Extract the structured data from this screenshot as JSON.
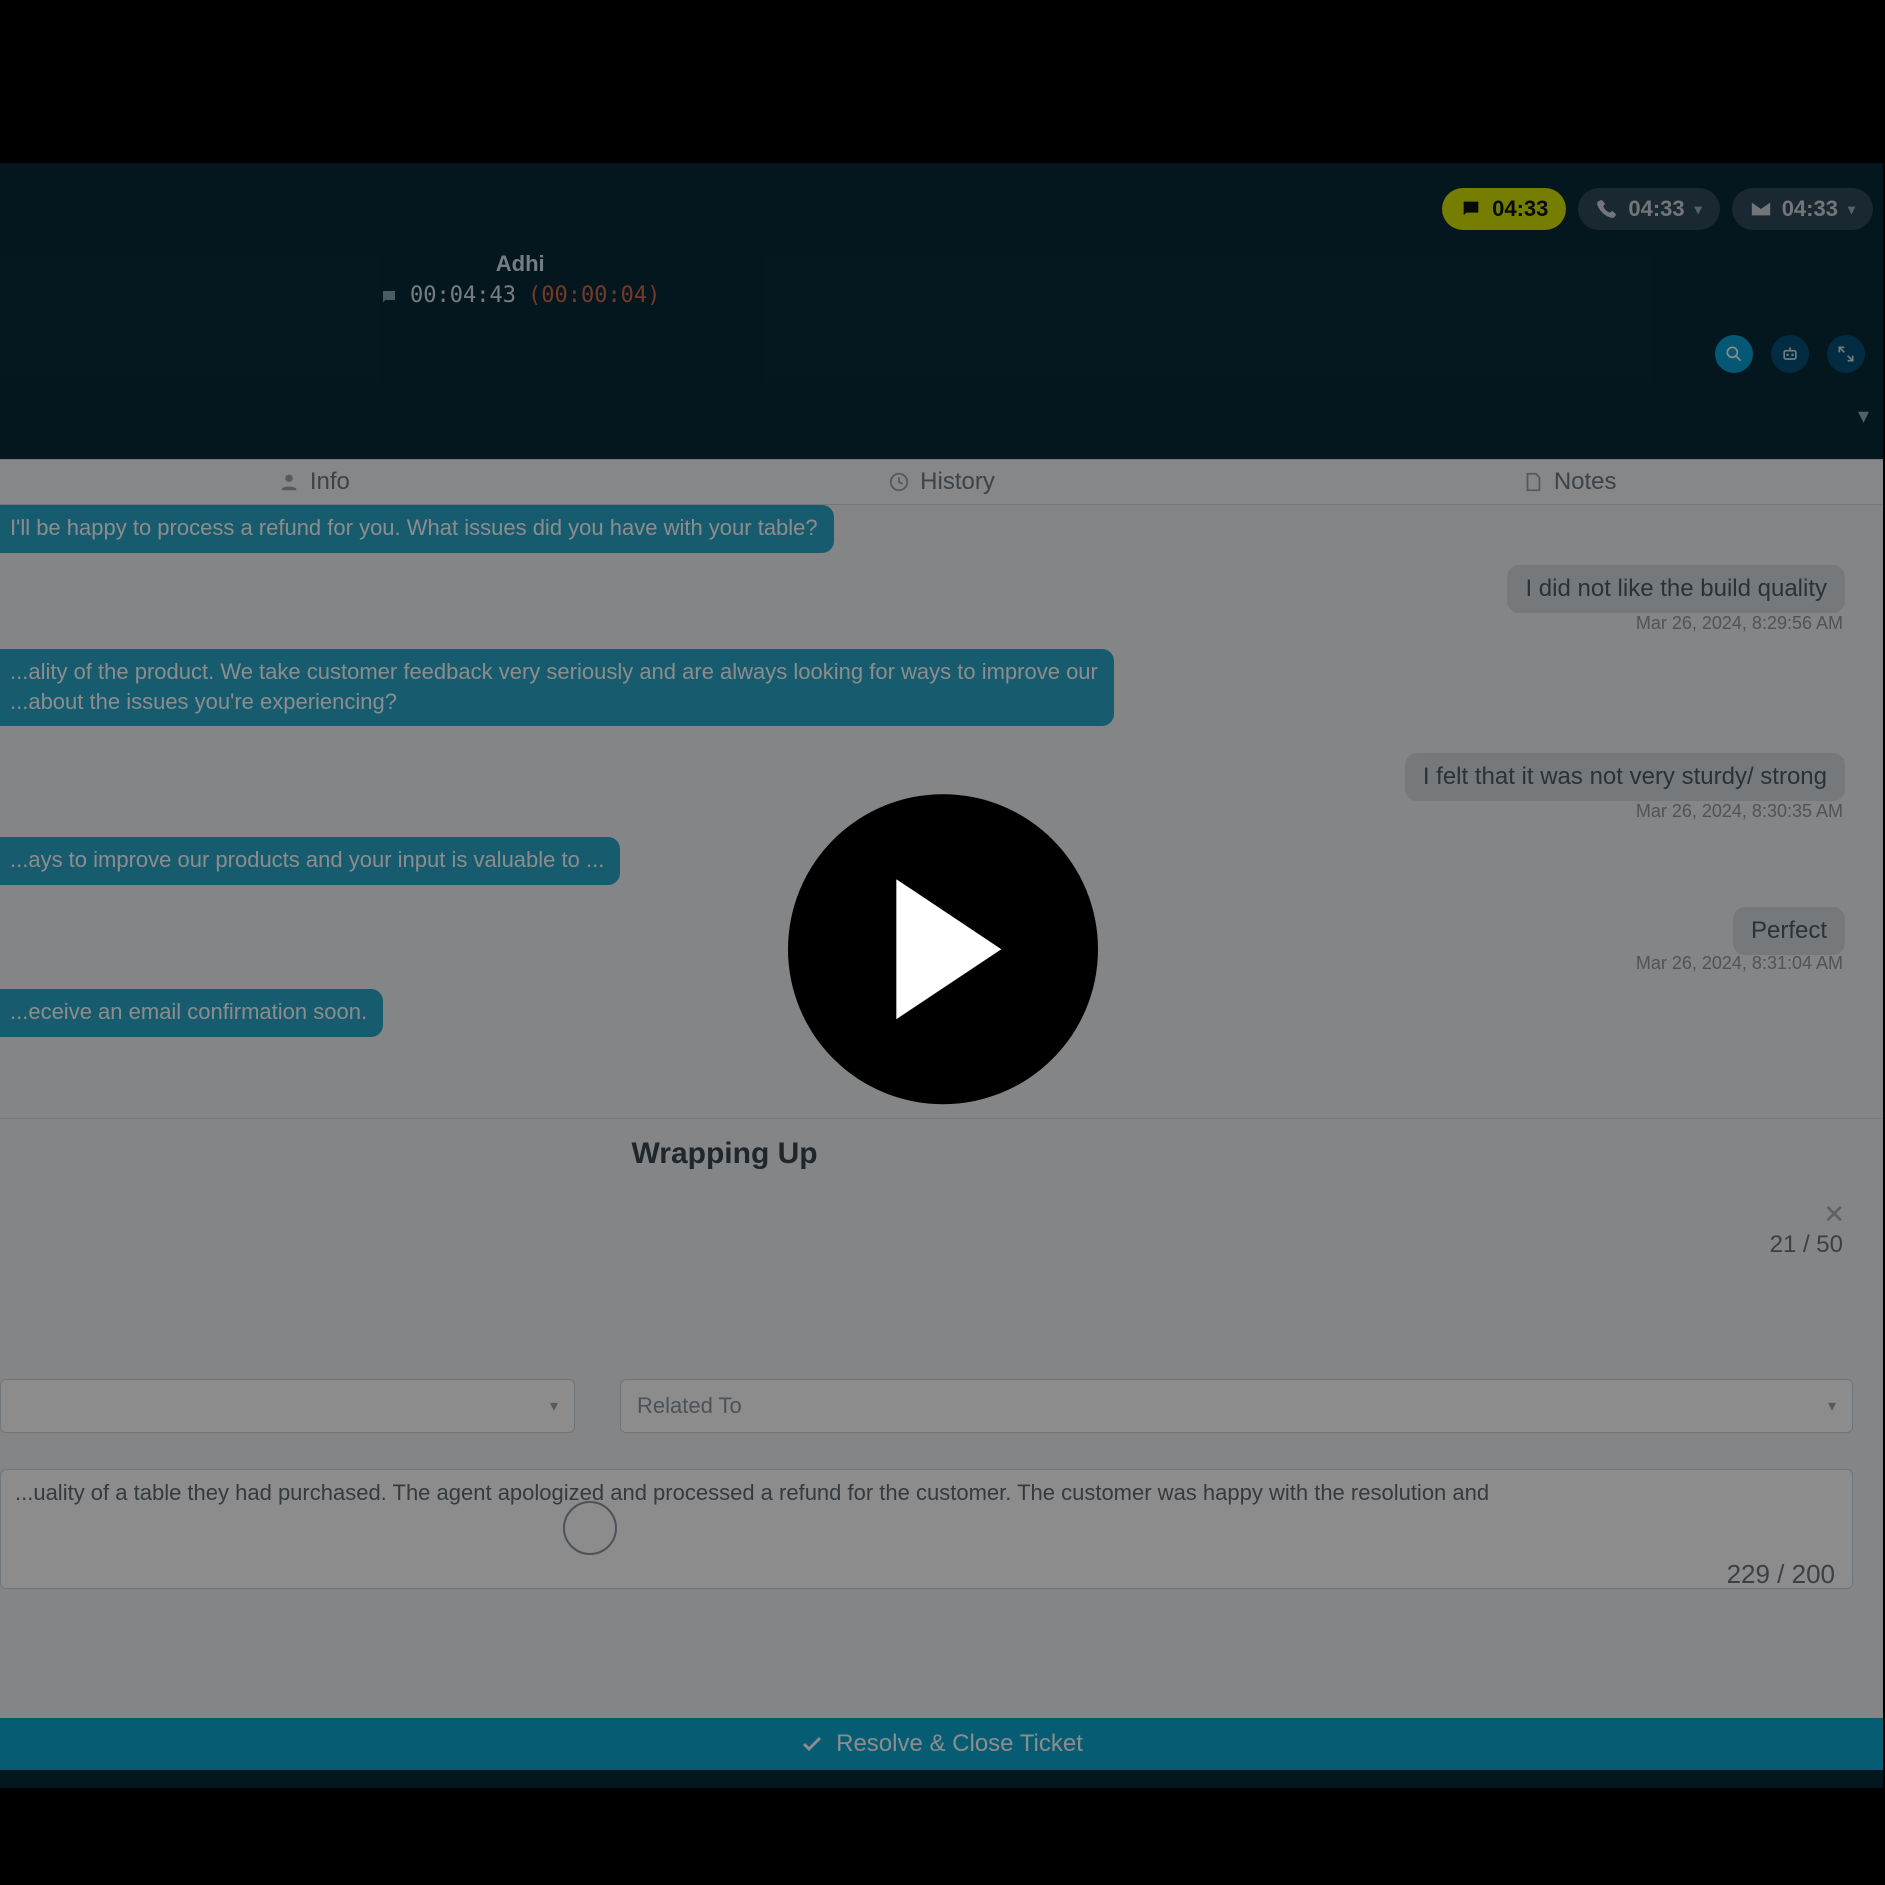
{
  "status_pills": {
    "chat": {
      "time": "04:33"
    },
    "phone": {
      "time": "04:33"
    },
    "email": {
      "time": "04:33"
    }
  },
  "contact": {
    "name": "Adhi",
    "elapsed": "00:04:43",
    "secondary": "(00:00:04)"
  },
  "tabs": {
    "info": "Info",
    "history": "History",
    "notes": "Notes"
  },
  "chat": {
    "agent1": "I'll be happy to process a refund for you. What issues did you have with your table?",
    "cust1": "I did not like the build quality",
    "ts1": "Mar 26, 2024, 8:29:56 AM",
    "agent2": "...ality of the product. We take customer feedback very seriously and are always looking for ways to improve our\n...about the issues you're experiencing?",
    "cust2": "I felt that it was not very sturdy/ strong",
    "ts2": "Mar 26, 2024, 8:30:35 AM",
    "agent3": "...ays to improve our products and your input is valuable to ...",
    "cust3": "Perfect",
    "ts3": "Mar 26, 2024, 8:31:04 AM",
    "agent4": "...eceive an email confirmation soon."
  },
  "wrapup": {
    "title": "Wrapping Up",
    "count1": "21 / 50",
    "related_to_placeholder": "Related To",
    "note": "...uality of a table they had purchased. The agent apologized and processed a refund for the customer. The customer was happy with the resolution and",
    "count2": "229 / 200",
    "resolve_label": "Resolve & Close Ticket"
  }
}
